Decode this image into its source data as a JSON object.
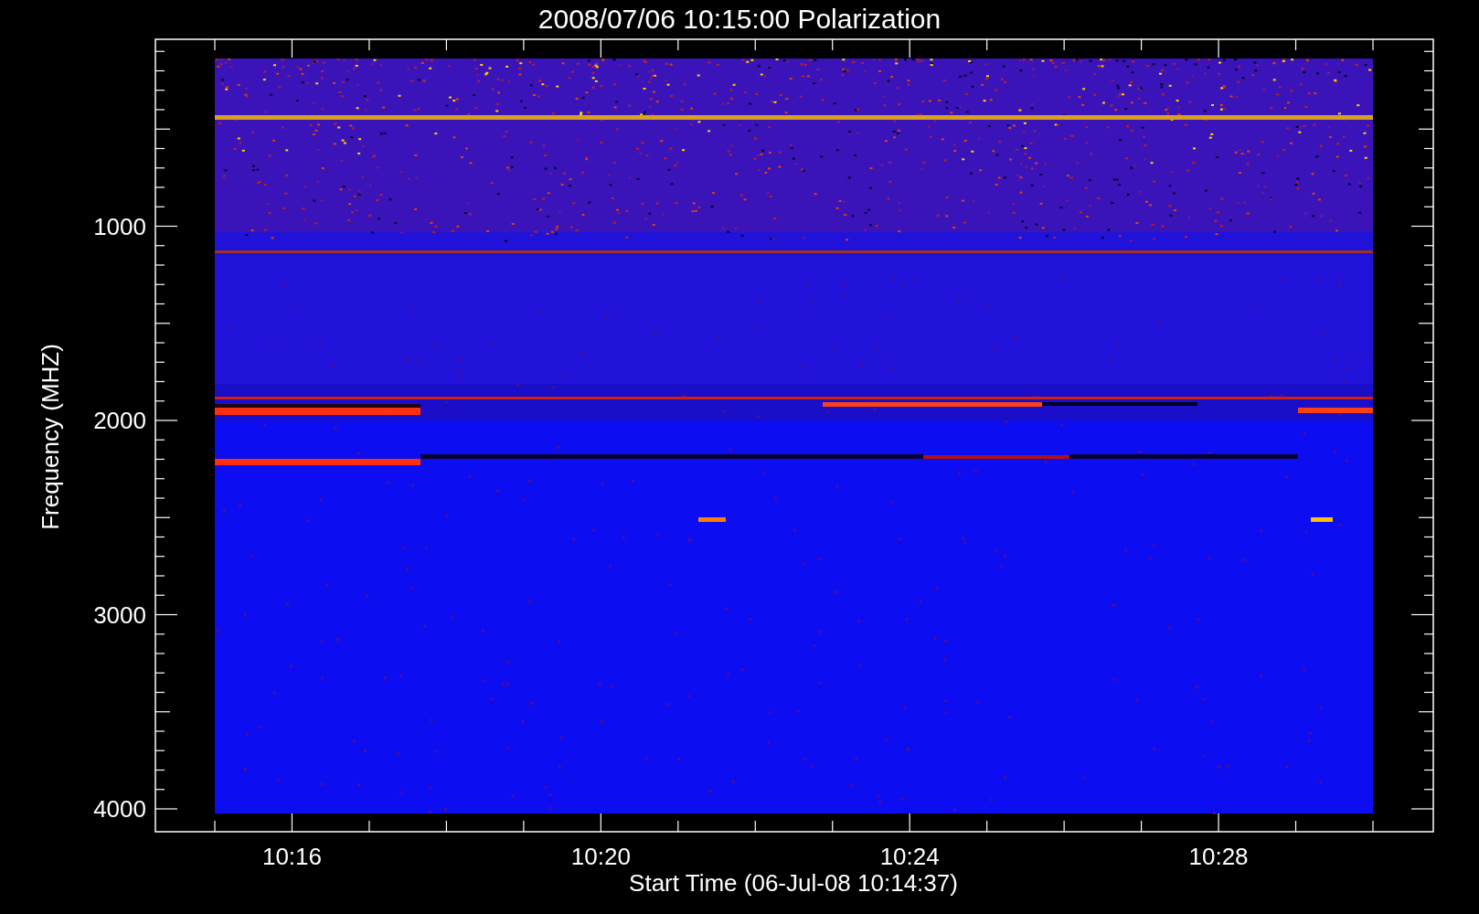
{
  "plot": {
    "title": "2008/07/06 10:15:00 Polarization",
    "x_axis": {
      "label": "Start Time (06-Jul-08 10:14:37)",
      "ticks": [
        "10:16",
        "10:20",
        "10:24",
        "10:28"
      ]
    },
    "y_axis": {
      "label": "Frequency (MHZ)",
      "ticks": [
        "1000",
        "2000",
        "3000",
        "4000"
      ]
    }
  }
}
